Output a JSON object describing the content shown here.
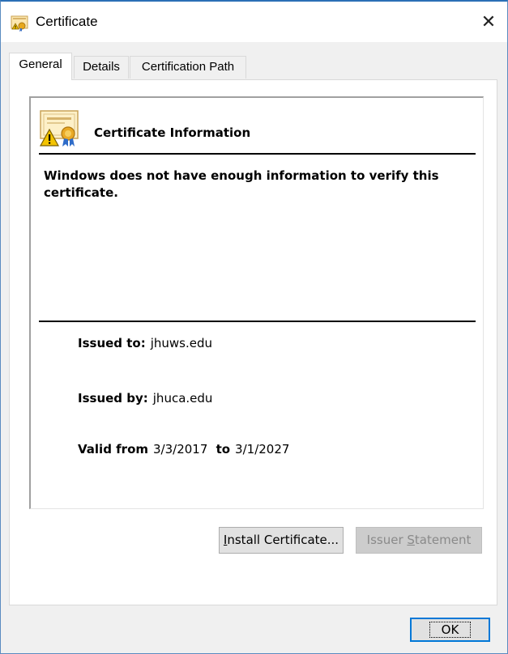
{
  "window": {
    "title": "Certificate",
    "icons": {
      "title": "certificate-icon",
      "close": "close-icon"
    },
    "close_glyph": "✕",
    "accent": "#2b6fb6"
  },
  "tabs": [
    {
      "label": "General",
      "active": true
    },
    {
      "label": "Details",
      "active": false
    },
    {
      "label": "Certification Path",
      "active": false
    }
  ],
  "info": {
    "icon": "certificate-warning-icon",
    "heading": "Certificate Information",
    "warning": "Windows does not have enough information to verify this certificate.",
    "issued_to_label": "Issued to:",
    "issued_to": "jhuws.edu",
    "issued_by_label": "Issued by:",
    "issued_by": "jhuca.edu",
    "valid_from_label": "Valid from",
    "valid_from": "3/3/2017",
    "valid_to_label": "to",
    "valid_to": "3/1/2027"
  },
  "buttons": {
    "install": {
      "pre": "",
      "accel": "I",
      "post": "nstall Certificate..."
    },
    "issuer": {
      "pre": "Issuer ",
      "accel": "S",
      "post": "tatement",
      "enabled": false
    },
    "ok": "OK"
  }
}
